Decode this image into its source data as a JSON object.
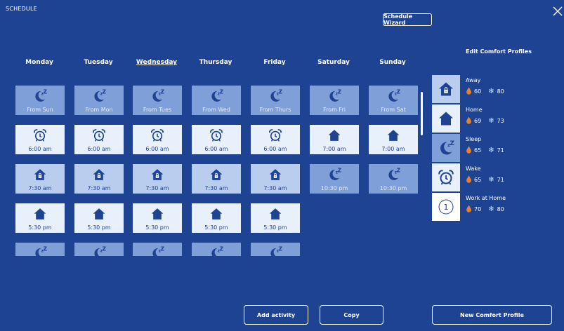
{
  "title": "SCHEDULE",
  "wizard_label": "Schedule Wizard",
  "days": [
    "Monday",
    "Tuesday",
    "Wednesday",
    "Thursday",
    "Friday",
    "Saturday",
    "Sunday"
  ],
  "selected_day": "Wednesday",
  "schedule": [
    [
      {
        "icon": "sleep",
        "label": "From Sun"
      },
      {
        "icon": "alarm",
        "label": "6:00 am"
      },
      {
        "icon": "away",
        "label": "7:30 am"
      },
      {
        "icon": "home",
        "label": "5:30 pm"
      },
      {
        "icon": "sleep",
        "label": ""
      }
    ],
    [
      {
        "icon": "sleep",
        "label": "From Mon"
      },
      {
        "icon": "alarm",
        "label": "6:00 am"
      },
      {
        "icon": "away",
        "label": "7:30 am"
      },
      {
        "icon": "home",
        "label": "5:30 pm"
      },
      {
        "icon": "sleep",
        "label": ""
      }
    ],
    [
      {
        "icon": "sleep",
        "label": "From Tues"
      },
      {
        "icon": "alarm",
        "label": "6:00 am"
      },
      {
        "icon": "away",
        "label": "7:30 am"
      },
      {
        "icon": "home",
        "label": "5:30 pm"
      },
      {
        "icon": "sleep",
        "label": ""
      }
    ],
    [
      {
        "icon": "sleep",
        "label": "From Wed"
      },
      {
        "icon": "alarm",
        "label": "6:00 am"
      },
      {
        "icon": "away",
        "label": "7:30 am"
      },
      {
        "icon": "home",
        "label": "5:30 pm"
      },
      {
        "icon": "sleep",
        "label": ""
      }
    ],
    [
      {
        "icon": "sleep",
        "label": "From Thurs"
      },
      {
        "icon": "alarm",
        "label": "6:00 am"
      },
      {
        "icon": "away",
        "label": "7:30 am"
      },
      {
        "icon": "home",
        "label": "5:30 pm"
      },
      {
        "icon": "sleep",
        "label": ""
      }
    ],
    [
      {
        "icon": "sleep",
        "label": "From Fri"
      },
      {
        "icon": "home",
        "label": "7:00 am"
      },
      {
        "icon": "sleep",
        "label": "10:30 pm"
      }
    ],
    [
      {
        "icon": "sleep",
        "label": "From Sat"
      },
      {
        "icon": "home",
        "label": "7:00 am"
      },
      {
        "icon": "sleep",
        "label": "10:30 pm"
      }
    ]
  ],
  "profiles_title": "Edit Comfort Profiles",
  "profiles": [
    {
      "name": "Away",
      "icon": "away",
      "heat": "60",
      "cool": "80"
    },
    {
      "name": "Home",
      "icon": "home",
      "heat": "69",
      "cool": "73"
    },
    {
      "name": "Sleep",
      "icon": "sleep",
      "heat": "65",
      "cool": "71"
    },
    {
      "name": "Wake",
      "icon": "alarm",
      "heat": "65",
      "cool": "71"
    },
    {
      "name": "Work at Home",
      "icon": "custom",
      "custom_number": "1",
      "heat": "70",
      "cool": "80"
    }
  ],
  "buttons": {
    "add_activity": "Add activity",
    "copy": "Copy",
    "new_profile": "New Comfort Profile"
  },
  "colors": {
    "background": "#1f4393",
    "tile_sleep": "#7f9fd8",
    "tile_light": "#e8f0fb",
    "tile_mid": "#b9cdee",
    "heat_drop": "#e8802c",
    "cool_snow": "#bfe3ff",
    "icon": "#1f4393"
  }
}
